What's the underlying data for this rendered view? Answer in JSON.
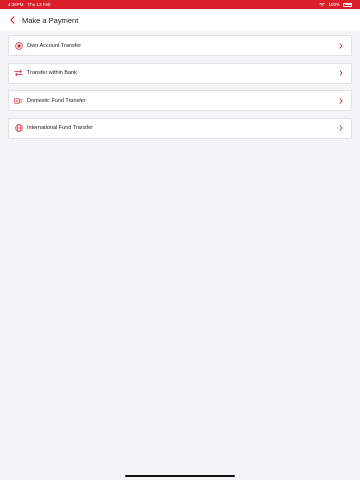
{
  "status_bar": {
    "time": "4:38PM",
    "date": "Thu 13 Feb",
    "battery": "100%"
  },
  "header": {
    "title": "Make a Payment"
  },
  "items": [
    {
      "label": "Own Account Transfer",
      "icon": "own-account-icon"
    },
    {
      "label": "Transfer within Bank",
      "icon": "transfer-arrows-icon"
    },
    {
      "label": "Domestic Fund Transfer",
      "icon": "domestic-transfer-icon"
    },
    {
      "label": "International Fund Transfer",
      "icon": "globe-icon"
    }
  ],
  "colors": {
    "brand": "#d9202a",
    "background": "#f4f4f6"
  }
}
